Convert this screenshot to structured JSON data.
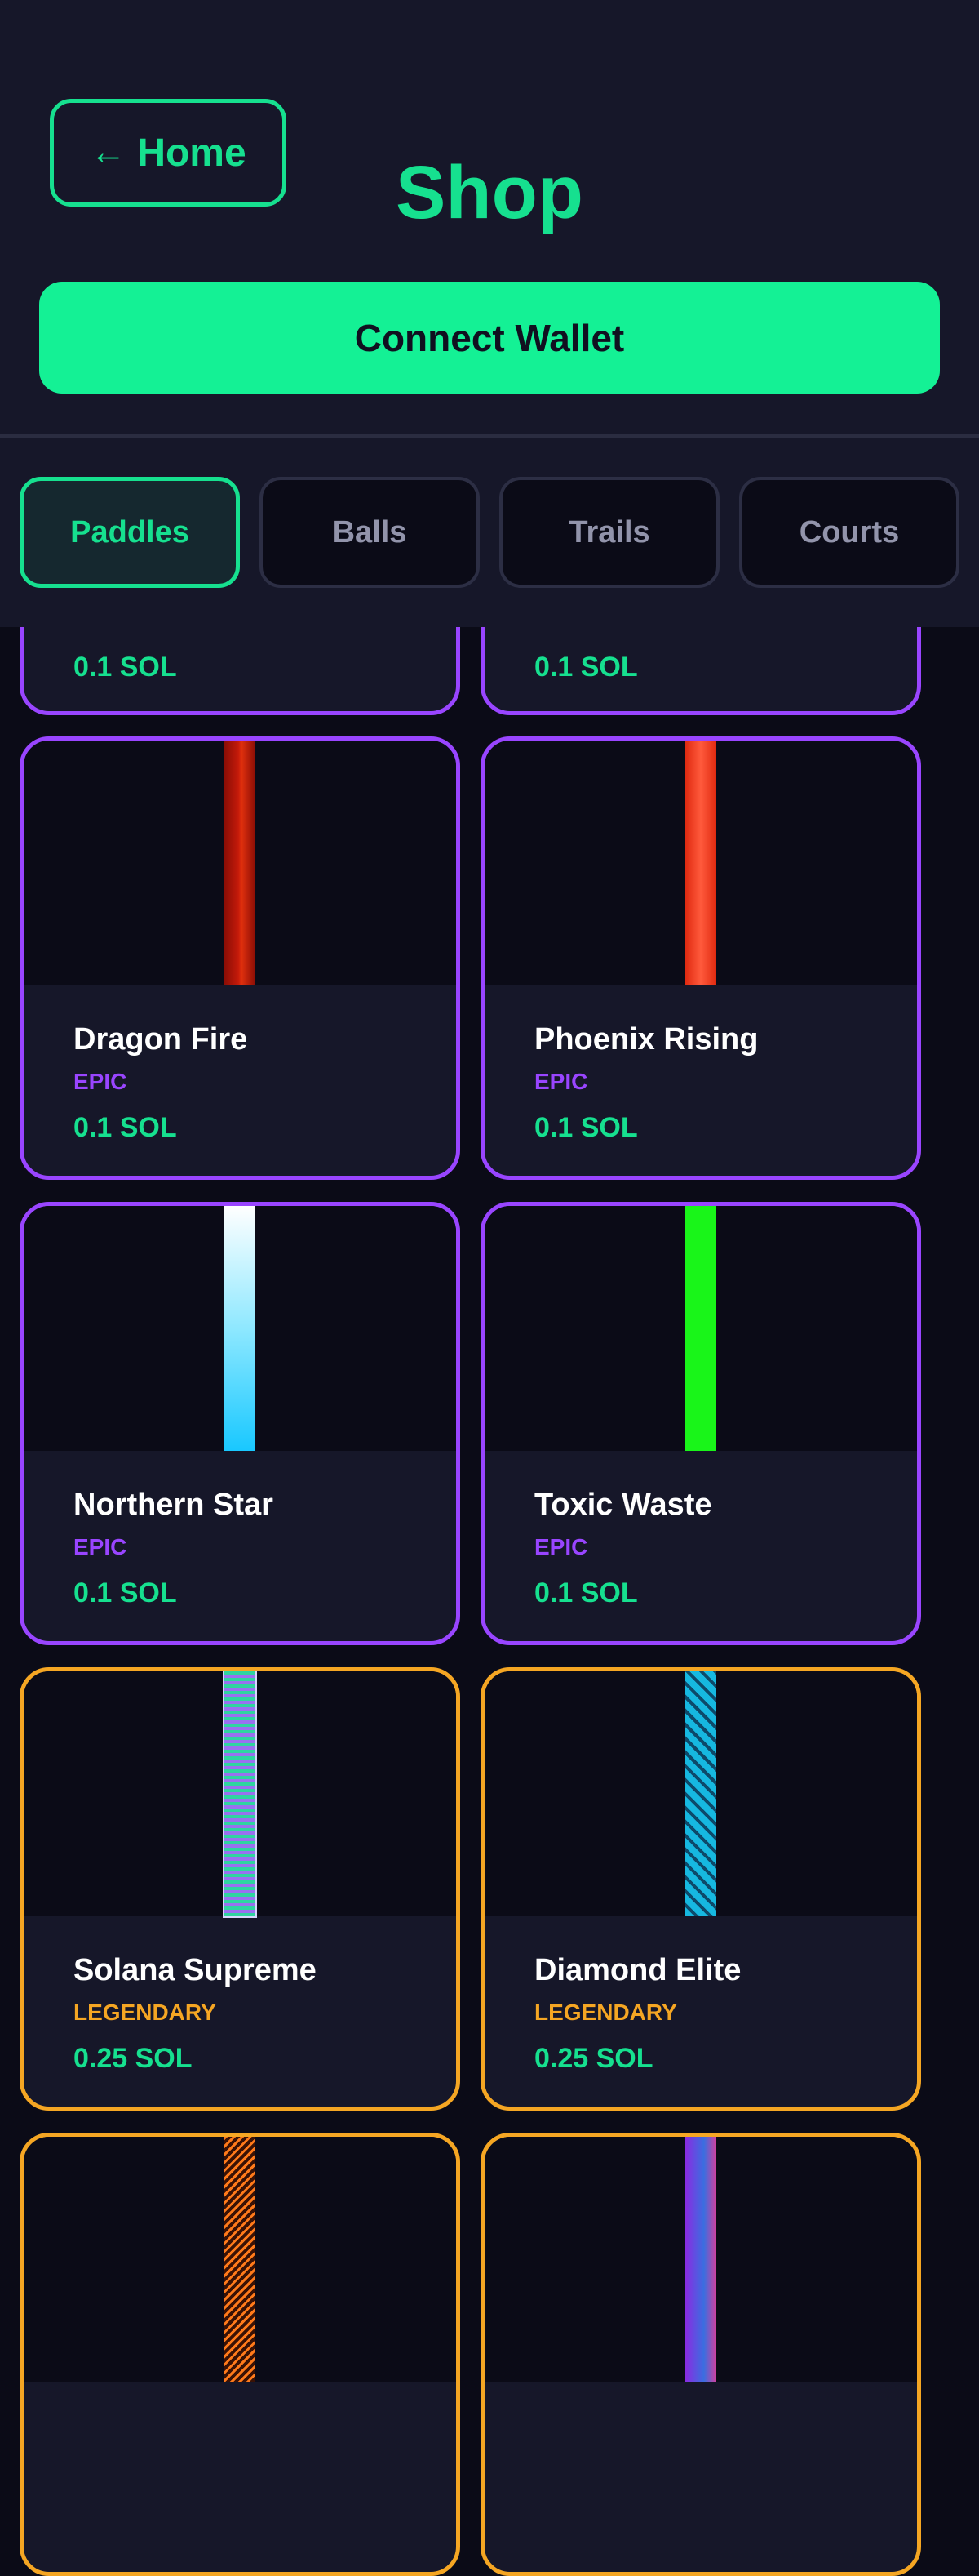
{
  "header": {
    "home_label": "Home",
    "home_arrow": "←",
    "title": "Shop",
    "wallet_label": "Connect Wallet"
  },
  "tabs": [
    {
      "label": "Paddles",
      "active": true
    },
    {
      "label": "Balls",
      "active": false
    },
    {
      "label": "Trails",
      "active": false
    },
    {
      "label": "Courts",
      "active": false
    }
  ],
  "items_top_partial": [
    {
      "price": "0.1 SOL"
    },
    {
      "price": "0.1 SOL"
    }
  ],
  "items": [
    {
      "name": "Dragon Fire",
      "rarity": "EPIC",
      "price": "0.1 SOL",
      "color": "#c81e0a"
    },
    {
      "name": "Phoenix Rising",
      "rarity": "EPIC",
      "price": "0.1 SOL",
      "color": "#ff5533"
    },
    {
      "name": "Northern Star",
      "rarity": "EPIC",
      "price": "0.1 SOL",
      "color": "#19d2ff"
    },
    {
      "name": "Toxic Waste",
      "rarity": "EPIC",
      "price": "0.1 SOL",
      "color": "#19ff19"
    },
    {
      "name": "Solana Supreme",
      "rarity": "LEGENDARY",
      "price": "0.25 SOL",
      "color": "#14f195"
    },
    {
      "name": "Diamond Elite",
      "rarity": "LEGENDARY",
      "price": "0.25 SOL",
      "color": "#1ec8e6"
    }
  ],
  "colors": {
    "accent": "#16e08f",
    "epic": "#9945ff",
    "legendary": "#f5a623",
    "background": "#0b0b17",
    "panel": "#161729"
  }
}
